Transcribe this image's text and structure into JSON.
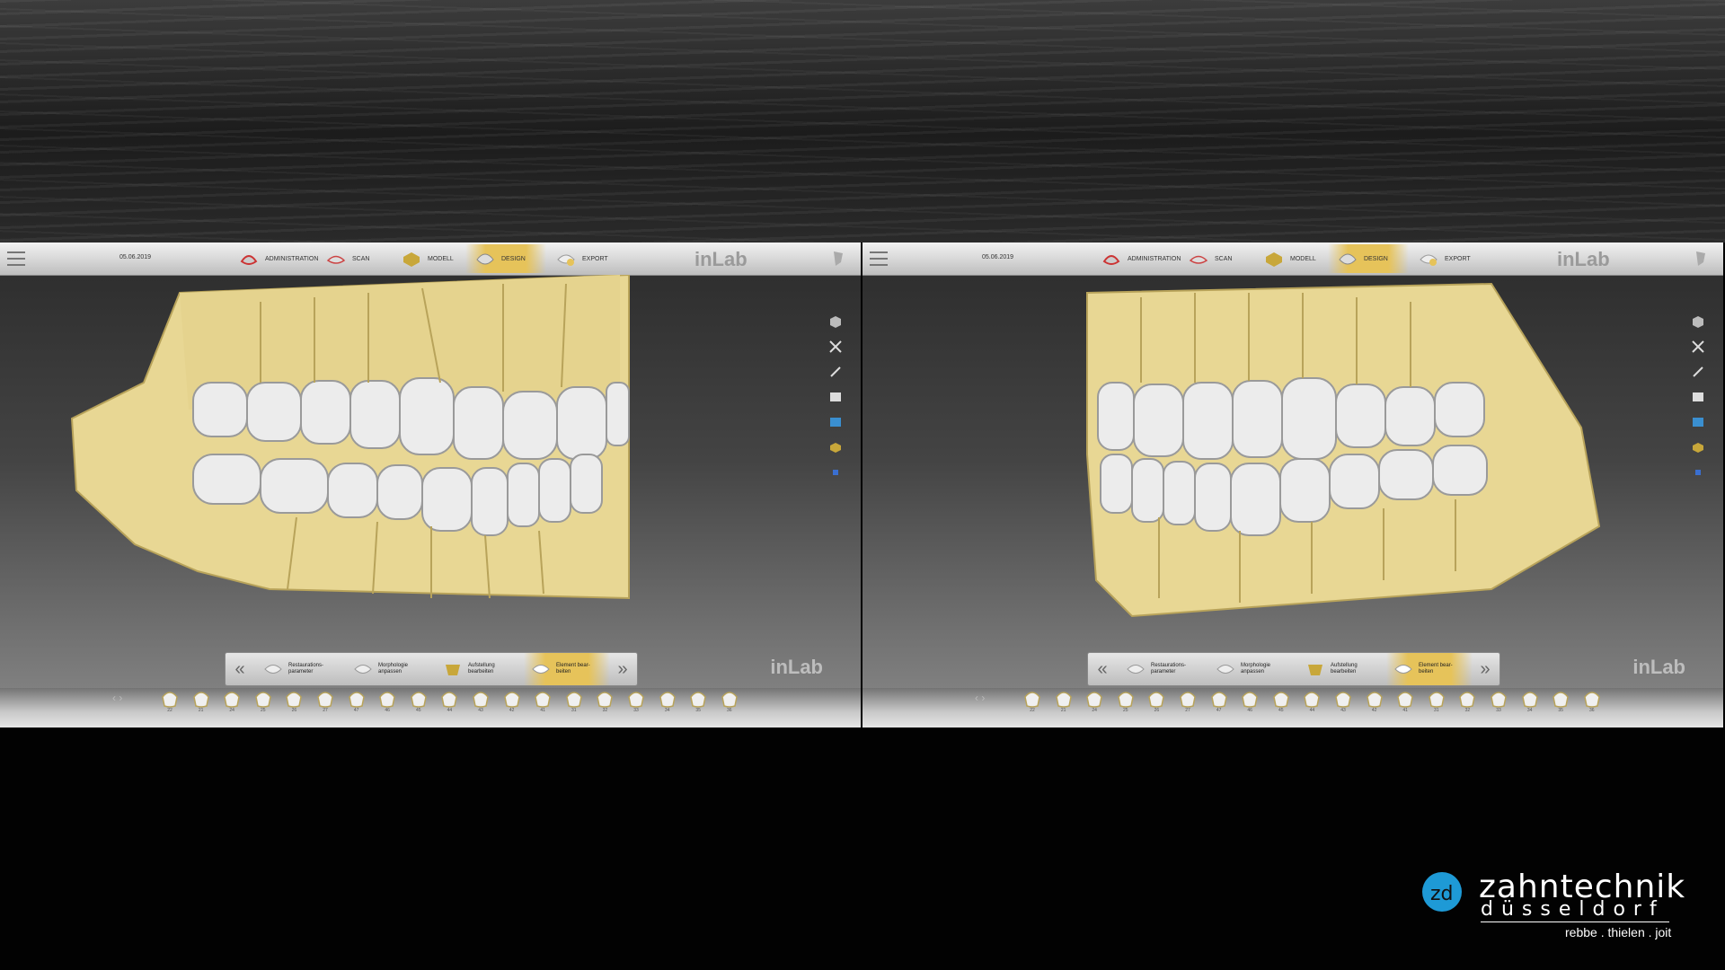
{
  "colors": {
    "accent": "#e6c35a",
    "tooth": "#e9e9e9",
    "gum": "#e8d794",
    "logo_blue": "#1e9ad6"
  },
  "header": {
    "date": "05.06.2019",
    "steps": [
      {
        "label": "ADMINISTRATION",
        "icon": "administration-icon"
      },
      {
        "label": "SCAN",
        "icon": "scan-icon"
      },
      {
        "label": "MODELL",
        "icon": "model-icon"
      },
      {
        "label": "DESIGN",
        "icon": "design-icon",
        "active": true
      },
      {
        "label": "EXPORT",
        "icon": "export-icon"
      }
    ],
    "brand": "inLab"
  },
  "workflow": {
    "items": [
      {
        "label": "Restaurations-\nparameter",
        "icon": "restoration-parameter-icon"
      },
      {
        "label": "Morphologie\nanpassen",
        "icon": "morphology-icon"
      },
      {
        "label": "Aufstellung\nbearbeiten",
        "icon": "arrangement-icon"
      },
      {
        "label": "Element bear-\nbeiten",
        "icon": "element-edit-icon",
        "active": true
      }
    ]
  },
  "side_tools": [
    "cube-view-icon",
    "tools-icon",
    "brush-icon",
    "library-icon",
    "screen-icon",
    "model-tool-icon",
    "layer-icon"
  ],
  "watermark": "inLab",
  "tooth_numbers": [
    "22",
    "21",
    "24",
    "25",
    "26",
    "27",
    "47",
    "46",
    "45",
    "44",
    "43",
    "42",
    "41",
    "31",
    "32",
    "33",
    "34",
    "35",
    "36"
  ],
  "logo": {
    "name": "zahntechnik",
    "city": "düsseldorf",
    "partners": "rebbe . thielen . joit"
  }
}
